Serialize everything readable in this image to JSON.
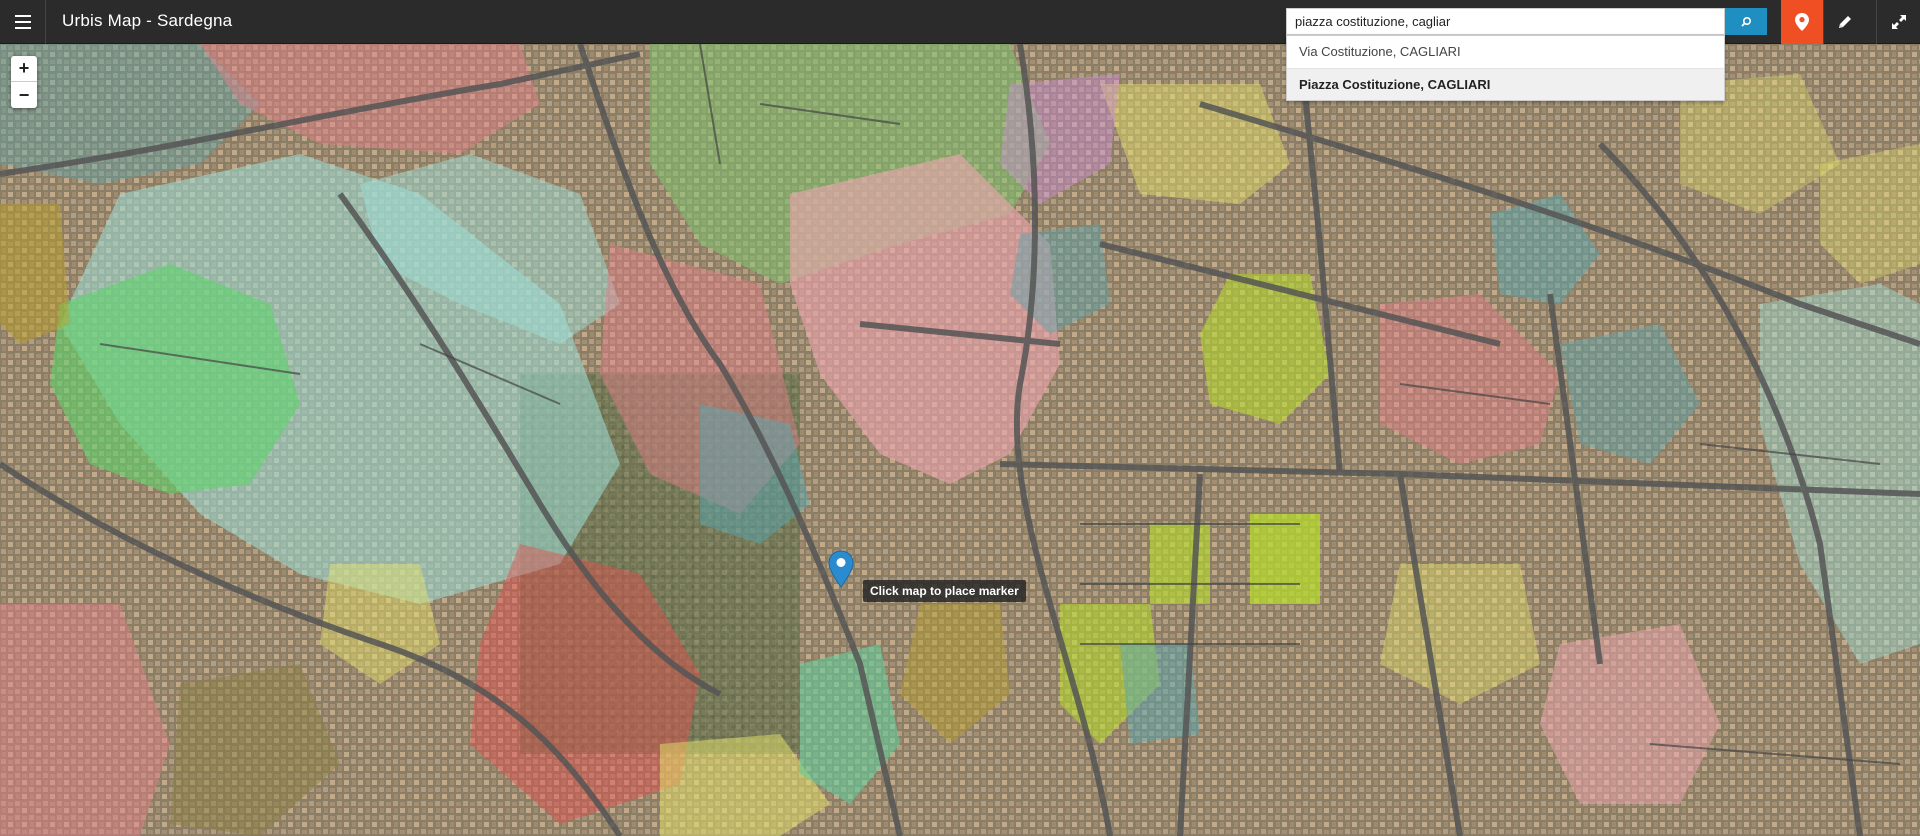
{
  "app": {
    "title": "Urbis Map - Sardegna"
  },
  "search": {
    "value": "piazza costituzione, cagliar",
    "suggestions": [
      "Via Costituzione, CAGLIARI",
      "Piazza Costituzione, CAGLIARI"
    ]
  },
  "toolbar": {
    "marker_color": "#f04e23",
    "search_color": "#1f8fc2"
  },
  "map": {
    "zoom_in": "+",
    "zoom_out": "−",
    "marker_tooltip": "Click map to place marker"
  }
}
